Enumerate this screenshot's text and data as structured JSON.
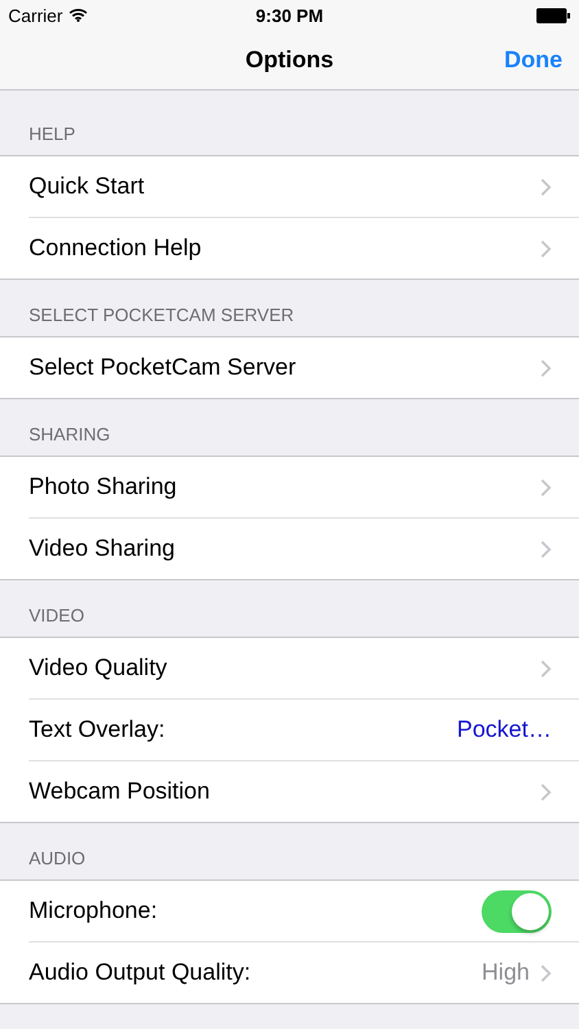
{
  "status_bar": {
    "carrier": "Carrier",
    "time": "9:30 PM"
  },
  "nav": {
    "title": "Options",
    "done": "Done"
  },
  "sections": [
    {
      "header": "HELP",
      "rows": [
        {
          "kind": "link",
          "label": "Quick Start"
        },
        {
          "kind": "link",
          "label": "Connection Help"
        }
      ]
    },
    {
      "header": "SELECT POCKETCAM SERVER",
      "rows": [
        {
          "kind": "link",
          "label": "Select PocketCam Server"
        }
      ]
    },
    {
      "header": "SHARING",
      "rows": [
        {
          "kind": "link",
          "label": "Photo Sharing"
        },
        {
          "kind": "link",
          "label": "Video Sharing"
        }
      ]
    },
    {
      "header": "VIDEO",
      "rows": [
        {
          "kind": "link",
          "label": "Video Quality"
        },
        {
          "kind": "value",
          "label": "Text Overlay:",
          "value": "Pocket…"
        },
        {
          "kind": "link",
          "label": "Webcam Position"
        }
      ]
    },
    {
      "header": "AUDIO",
      "rows": [
        {
          "kind": "toggle",
          "label": "Microphone:",
          "on": true
        },
        {
          "kind": "detail",
          "label": "Audio Output Quality:",
          "value": "High"
        }
      ]
    }
  ]
}
